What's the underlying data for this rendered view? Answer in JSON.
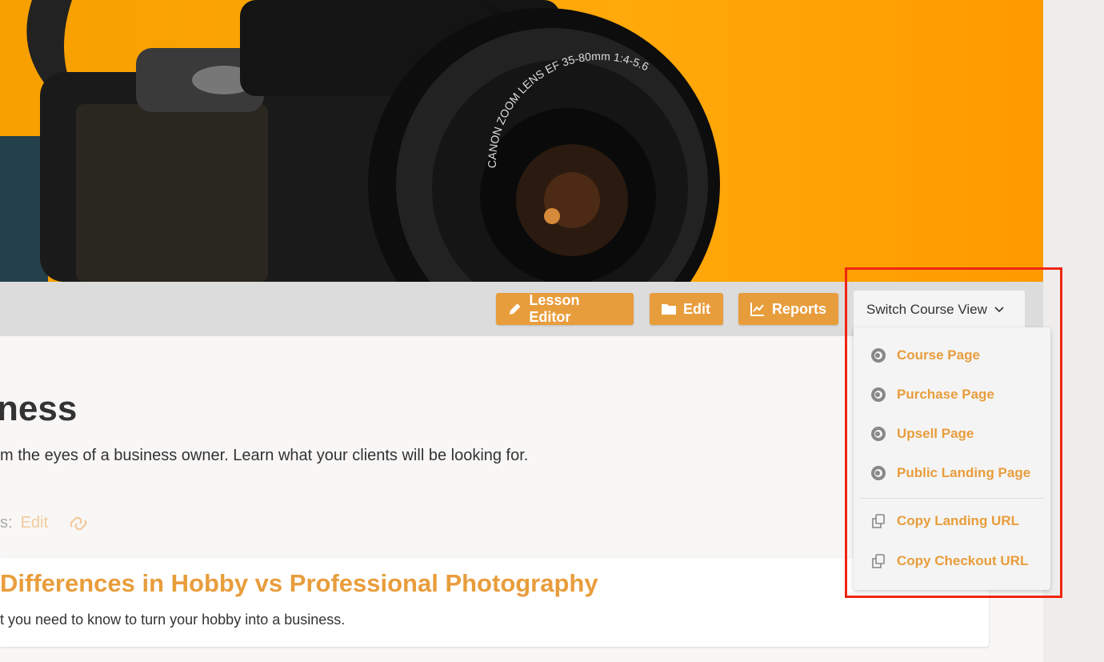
{
  "colors": {
    "accent": "#e89d3c",
    "highlight": "#f0250f",
    "hero": "#ffa90a"
  },
  "hero": {
    "lens_text": "CANON ZOOM LENS EF 35-80mm 1:4-5.6"
  },
  "toolbar": {
    "buttons": [
      {
        "label": "Lesson Editor",
        "icon": "pencil-icon"
      },
      {
        "label": "Edit",
        "icon": "folder-icon"
      },
      {
        "label": "Reports",
        "icon": "chart-line-icon"
      }
    ],
    "switch_view": {
      "label": "Switch Course View",
      "icon": "chevron-down-icon"
    }
  },
  "menu": {
    "items": [
      {
        "label": "Course Page",
        "icon": "eye-icon"
      },
      {
        "label": "Purchase Page",
        "icon": "eye-icon"
      },
      {
        "label": "Upsell Page",
        "icon": "eye-icon"
      },
      {
        "label": "Public Landing Page",
        "icon": "eye-icon"
      },
      {
        "label": "Copy Landing URL",
        "icon": "copy-icon"
      },
      {
        "label": "Copy Checkout URL",
        "icon": "copy-icon"
      }
    ]
  },
  "course": {
    "title": "ness",
    "description": "m the eyes of a business owner. Learn what your clients will be looking for.",
    "meta_label": "s:",
    "meta_edit": "Edit"
  },
  "lesson": {
    "title": "Differences in Hobby vs Professional Photography",
    "description": "t you need to know to turn your hobby into a business."
  }
}
